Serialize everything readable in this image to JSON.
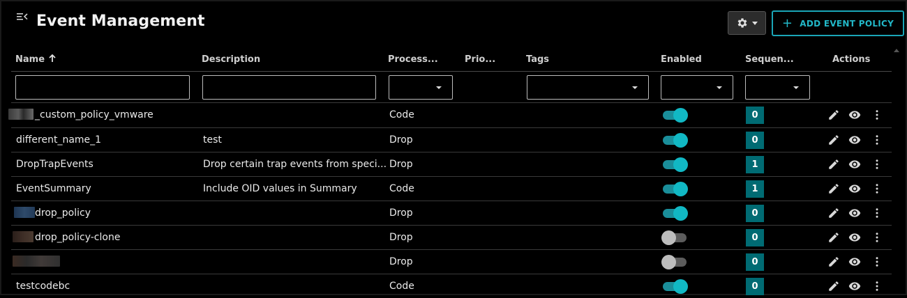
{
  "header": {
    "title": "Event Management",
    "add_button_label": "ADD EVENT POLICY",
    "add_button_icon": "plus-icon",
    "settings_icon": "gear-icon"
  },
  "table": {
    "columns": [
      "Name",
      "Description",
      "Process...",
      "Prio...",
      "Tags",
      "Enabled",
      "Sequen...",
      "Actions"
    ],
    "sort": {
      "column": "Name",
      "direction": "ascending"
    },
    "filters": {
      "name": "",
      "description": "",
      "processing": "",
      "tags": "",
      "enabled": "",
      "sequence": ""
    },
    "rows": [
      {
        "name": "_custom_policy_vmware",
        "description": "",
        "processing": "Code",
        "priority": "",
        "enabled": true,
        "sequence": "0"
      },
      {
        "name": "different_name_1",
        "description": "test",
        "processing": "Drop",
        "priority": "",
        "enabled": true,
        "sequence": "0"
      },
      {
        "name": "DropTrapEvents",
        "description": "Drop certain trap events from speci...",
        "processing": "Drop",
        "priority": "",
        "enabled": true,
        "sequence": "1"
      },
      {
        "name": "EventSummary",
        "description": "Include OID values in Summary",
        "processing": "Code",
        "priority": "",
        "enabled": true,
        "sequence": "1"
      },
      {
        "name": "drop_policy",
        "description": "",
        "processing": "Drop",
        "priority": "",
        "enabled": true,
        "sequence": "0"
      },
      {
        "name": "drop_policy-clone",
        "description": "",
        "processing": "Drop",
        "priority": "",
        "enabled": false,
        "sequence": "0"
      },
      {
        "name": "",
        "description": "",
        "processing": "Drop",
        "priority": "",
        "enabled": false,
        "sequence": "0"
      },
      {
        "name": "testcodebc",
        "description": "",
        "processing": "Code",
        "priority": "",
        "enabled": true,
        "sequence": "0"
      }
    ]
  },
  "colors": {
    "accent": "#1aa6b7",
    "sequence_badge": "#006b73",
    "toggle_on": "#11b8c4",
    "toggle_off": "#bdbdbd"
  },
  "icons": {
    "edit": "pencil-icon",
    "view": "eye-icon",
    "more": "more-vertical-icon"
  }
}
